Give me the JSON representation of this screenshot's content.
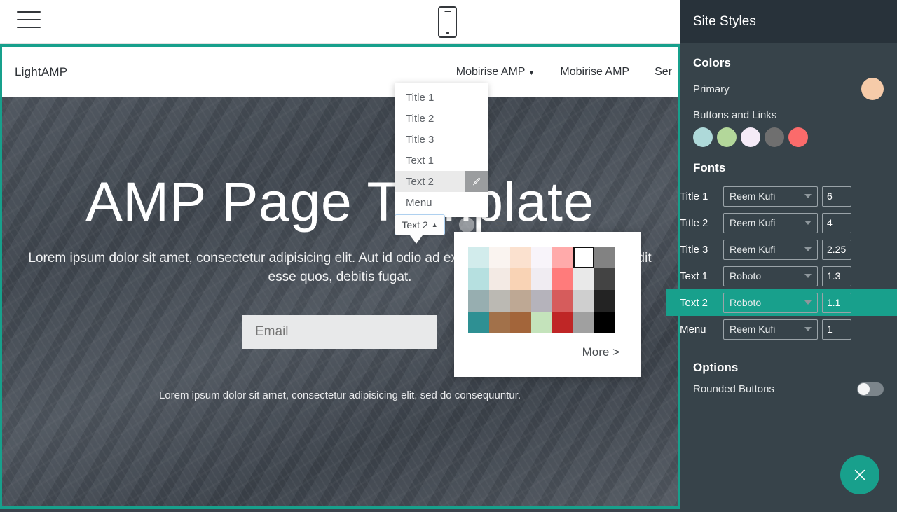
{
  "editor_toolbar": {
    "menu_icon": "hamburger-menu-icon",
    "device_icon": "mobile-preview-icon"
  },
  "preview": {
    "nav": {
      "brand": "LightAMP",
      "links": [
        {
          "label": "Mobirise AMP",
          "has_caret": true
        },
        {
          "label": "Mobirise AMP",
          "has_caret": false
        },
        {
          "label": "Ser",
          "has_caret": false
        }
      ]
    },
    "hero": {
      "title": "AMP Page Template",
      "subtitle": "Lorem ipsum dolor sit amet, consectetur adipisicing elit. Aut id odio ad exercitationem voluptatibus impedit esse quos, debitis fugat.",
      "email_placeholder": "Email",
      "footer_text": "Lorem ipsum dolor sit amet, consectetur adipisicing elit, sed do consequuntur."
    }
  },
  "tag_menu": {
    "items": [
      {
        "label": "Title 1",
        "active": false
      },
      {
        "label": "Title 2",
        "active": false
      },
      {
        "label": "Title 3",
        "active": false
      },
      {
        "label": "Text 1",
        "active": false
      },
      {
        "label": "Text 2",
        "active": true
      },
      {
        "label": "Menu",
        "active": false
      }
    ]
  },
  "inline_toolbar": {
    "tag_label": "Text 2",
    "caret": "▲",
    "color_swatch_name": "text-color-swatch",
    "align_icon": "align-icon"
  },
  "palette": {
    "more_label": "More >",
    "selected_index": 5,
    "colors": [
      "#d2ecec",
      "#faf4f0",
      "#fbe1cf",
      "#f8f4fa",
      "#ffaaaa",
      "#ffffff",
      "#828282",
      "#b6e0e0",
      "#f3eae4",
      "#f9d3b5",
      "#f0ecf2",
      "#ff7b7b",
      "#e9e9e9",
      "#434343",
      "#97aeb0",
      "#bbb9b3",
      "#bea894",
      "#b5b3bb",
      "#d65c5c",
      "#cfcfcf",
      "#232323",
      "#2e9093",
      "#a2714a",
      "#a3653a",
      "#c4e3bb",
      "#bf2626",
      "#a0a0a0",
      "#000000"
    ]
  },
  "panel": {
    "title": "Site Styles",
    "colors_heading": "Colors",
    "primary_label": "Primary",
    "primary_color": "#f6cba9",
    "buttons_links_label": "Buttons and Links",
    "button_colors": [
      "#aed9d9",
      "#b3d79a",
      "#f5ebf7",
      "#6f6f6f",
      "#fb6b6b"
    ],
    "fonts_heading": "Fonts",
    "fonts": [
      {
        "label": "Title 1",
        "family": "Reem Kufi",
        "size": "6",
        "selected": false
      },
      {
        "label": "Title 2",
        "family": "Reem Kufi",
        "size": "4",
        "selected": false
      },
      {
        "label": "Title 3",
        "family": "Reem Kufi",
        "size": "2.25",
        "selected": false
      },
      {
        "label": "Text 1",
        "family": "Roboto",
        "size": "1.3",
        "selected": false
      },
      {
        "label": "Text 2",
        "family": "Roboto",
        "size": "1.1",
        "selected": true
      },
      {
        "label": "Menu",
        "family": "Reem Kufi",
        "size": "1",
        "selected": false
      }
    ],
    "options_heading": "Options",
    "rounded_buttons_label": "Rounded Buttons",
    "rounded_buttons_on": false,
    "accent_color": "#18a08c",
    "close_icon": "close-icon"
  }
}
